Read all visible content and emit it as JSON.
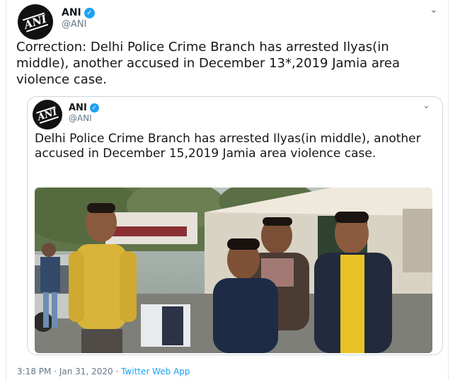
{
  "tweet": {
    "author_name": "ANI",
    "handle": "@ANI",
    "avatar_text": "ANI",
    "text": "Correction: Delhi Police Crime Branch has arrested Ilyas(in middle), another accused in December 13*,2019 Jamia area violence case.",
    "time": "3:18 PM",
    "separator": "·",
    "date": "Jan 31, 2020",
    "source": "Twitter Web App"
  },
  "quoted": {
    "author_name": "ANI",
    "handle": "@ANI",
    "avatar_text": "ANI",
    "text": "Delhi Police Crime Branch has arrested Ilyas(in middle), another accused in December 15,2019 Jamia area violence case."
  },
  "icons": {
    "menu": "chevron-down-icon",
    "verified": "verified-badge-icon"
  },
  "colors": {
    "accent": "#1da1f2",
    "secondary_text": "#657786",
    "border": "#ccd6dd"
  }
}
